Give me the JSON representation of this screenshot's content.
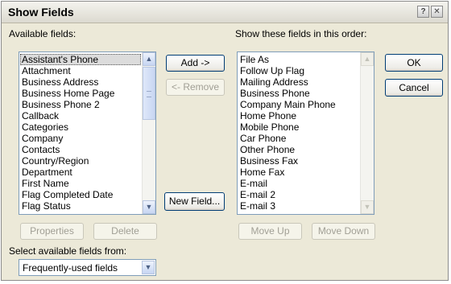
{
  "dialog": {
    "title": "Show Fields",
    "help_glyph": "?",
    "close_glyph": "✕"
  },
  "available": {
    "label": "Available fields:",
    "items": [
      "Assistant's Phone",
      "Attachment",
      "Business Address",
      "Business Home Page",
      "Business Phone 2",
      "Callback",
      "Categories",
      "Company",
      "Contacts",
      "Country/Region",
      "Department",
      "First Name",
      "Flag Completed Date",
      "Flag Status"
    ],
    "selected_index": 0
  },
  "shown": {
    "label": "Show these fields in this order:",
    "items": [
      "File As",
      "Follow Up Flag",
      "Mailing Address",
      "Business Phone",
      "Company Main Phone",
      "Home Phone",
      "Mobile Phone",
      "Car Phone",
      "Other Phone",
      "Business Fax",
      "Home Fax",
      "E-mail",
      "E-mail 2",
      "E-mail 3"
    ]
  },
  "buttons": {
    "add": "Add ->",
    "remove": "<- Remove",
    "new_field": "New Field...",
    "ok": "OK",
    "cancel": "Cancel",
    "properties": "Properties",
    "delete": "Delete",
    "move_up": "Move Up",
    "move_down": "Move Down"
  },
  "source": {
    "label": "Select available fields from:",
    "value": "Frequently-used fields"
  },
  "icons": {
    "scroll_up": "▲",
    "scroll_down": "▼",
    "dropdown": "▼"
  }
}
